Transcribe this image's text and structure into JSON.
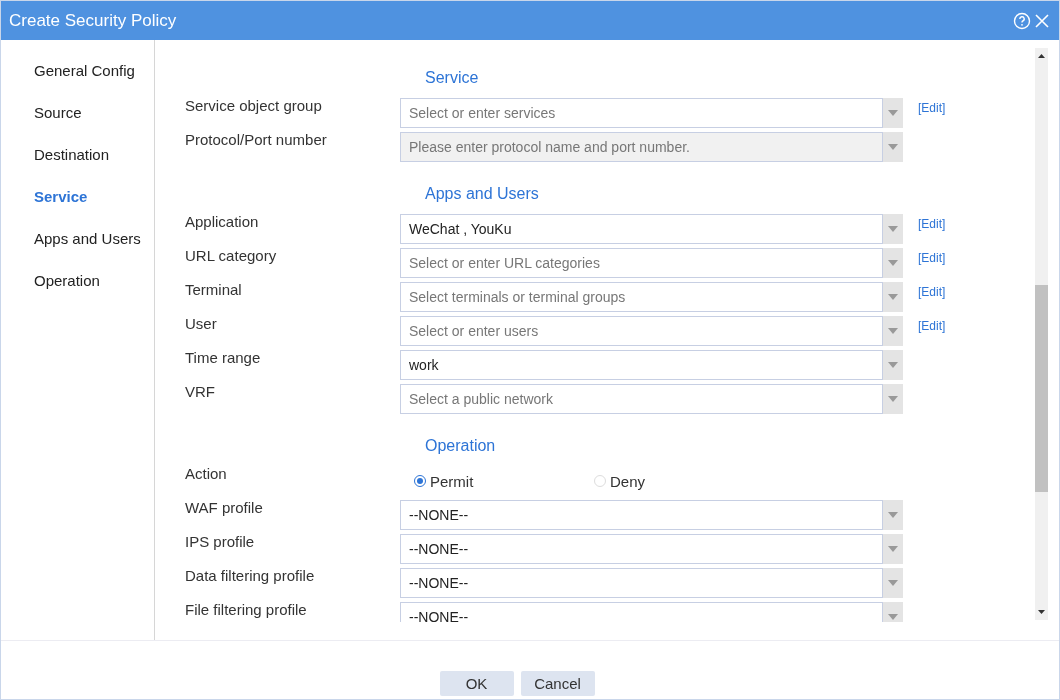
{
  "window": {
    "title": "Create Security Policy"
  },
  "sidebar": {
    "items": [
      {
        "label": "General Config",
        "selected": false
      },
      {
        "label": "Source",
        "selected": false
      },
      {
        "label": "Destination",
        "selected": false
      },
      {
        "label": "Service",
        "selected": true
      },
      {
        "label": "Apps and Users",
        "selected": false
      },
      {
        "label": "Operation",
        "selected": false
      }
    ]
  },
  "sections": [
    {
      "title": "Service",
      "rows": [
        {
          "kind": "select",
          "label": "Service object group",
          "placeholder": "Select or enter services",
          "readonly": false,
          "edit": "[Edit]"
        },
        {
          "kind": "select",
          "label": "Protocol/Port number",
          "placeholder": "Please enter protocol name and port number.",
          "readonly": true
        }
      ]
    },
    {
      "title": "Apps and Users",
      "rows": [
        {
          "kind": "select",
          "label": "Application",
          "value": "WeChat , YouKu",
          "readonly": false,
          "edit": "[Edit]"
        },
        {
          "kind": "select",
          "label": "URL category",
          "placeholder": "Select or enter URL categories",
          "readonly": false,
          "edit": "[Edit]"
        },
        {
          "kind": "select",
          "label": "Terminal",
          "placeholder": "Select terminals or terminal groups",
          "readonly": false,
          "edit": "[Edit]"
        },
        {
          "kind": "select",
          "label": "User",
          "placeholder": "Select or enter users",
          "readonly": false,
          "edit": "[Edit]"
        },
        {
          "kind": "select",
          "label": "Time range",
          "value": "work",
          "readonly": false
        },
        {
          "kind": "select",
          "label": "VRF",
          "placeholder": "Select a public network",
          "readonly": false
        }
      ]
    },
    {
      "title": "Operation",
      "rows": [
        {
          "kind": "radio",
          "label": "Action",
          "options": [
            {
              "label": "Permit",
              "selected": true
            },
            {
              "label": "Deny",
              "selected": false
            }
          ]
        },
        {
          "kind": "select",
          "label": "WAF profile",
          "value": "--NONE--",
          "readonly": false
        },
        {
          "kind": "select",
          "label": "IPS profile",
          "value": "--NONE--",
          "readonly": false
        },
        {
          "kind": "select",
          "label": "Data filtering profile",
          "value": "--NONE--",
          "readonly": false
        },
        {
          "kind": "select",
          "label": "File filtering profile",
          "value": "--NONE--",
          "readonly": false
        }
      ]
    }
  ],
  "buttons": [
    "OK",
    "Cancel"
  ]
}
